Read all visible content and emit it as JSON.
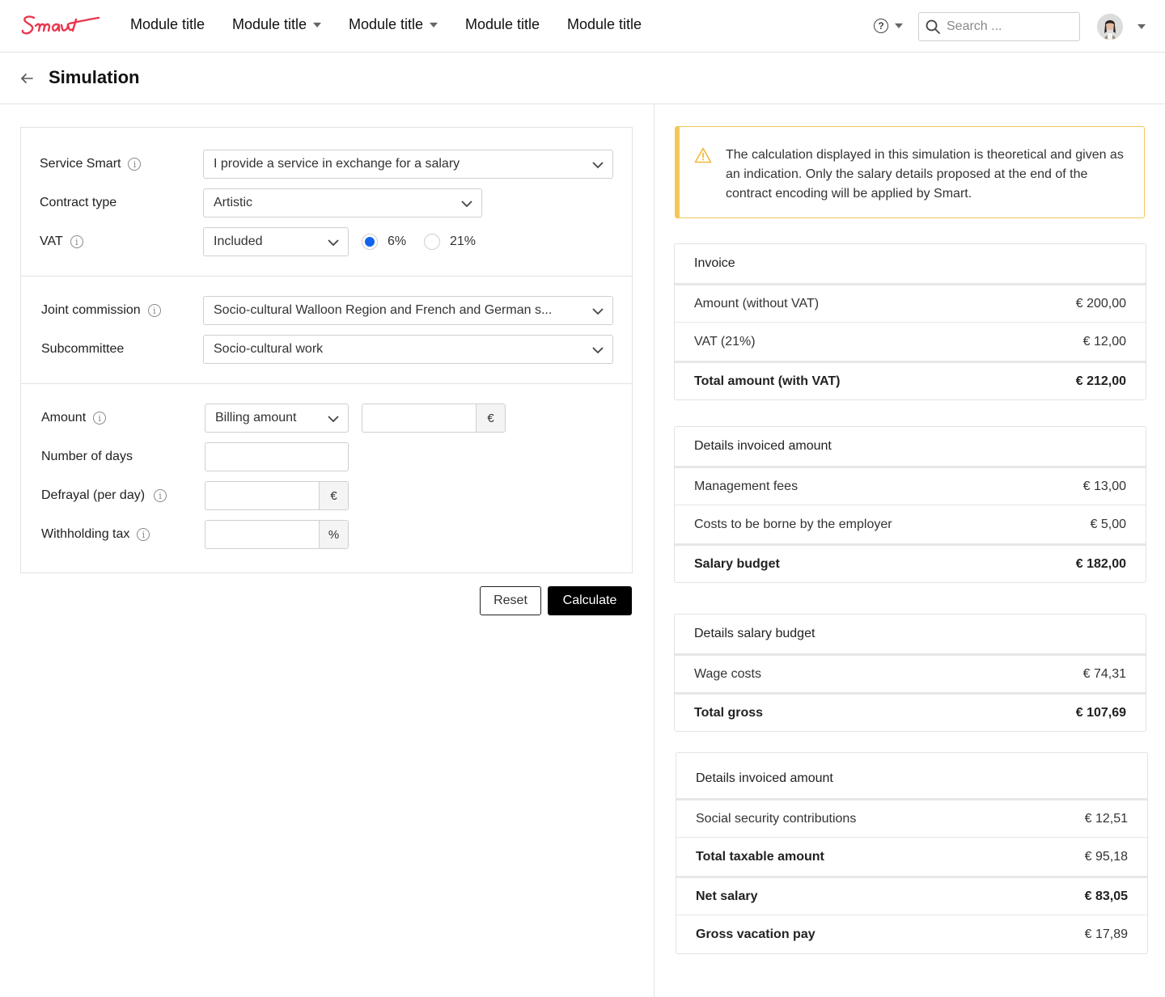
{
  "brand": {
    "logo_text": "Smart",
    "accent": "#e8384f"
  },
  "nav": {
    "items": [
      {
        "label": "Module title",
        "has_dropdown": false
      },
      {
        "label": "Module title",
        "has_dropdown": true
      },
      {
        "label": "Module title",
        "has_dropdown": true
      },
      {
        "label": "Module title",
        "has_dropdown": false
      },
      {
        "label": "Module title",
        "has_dropdown": false
      }
    ],
    "help_icon": "question-circle-icon",
    "search_placeholder": "Search ...",
    "avatar_icon": "user-avatar"
  },
  "page": {
    "title": "Simulation",
    "back_icon": "arrow-left-icon"
  },
  "form": {
    "service_smart": {
      "label": "Service Smart",
      "value": "I provide a service in exchange for a salary"
    },
    "contract_type": {
      "label": "Contract type",
      "value": "Artistic"
    },
    "vat": {
      "label": "VAT",
      "value": "Included",
      "options": [
        {
          "label": "6%",
          "selected": true
        },
        {
          "label": "21%",
          "selected": false
        }
      ]
    },
    "joint_commission": {
      "label": "Joint commission",
      "value": "Socio-cultural Walloon Region and French and German s..."
    },
    "subcommittee": {
      "label": "Subcommittee",
      "value": "Socio-cultural work"
    },
    "amount": {
      "label": "Amount",
      "type_value": "Billing amount",
      "value": "",
      "unit": "€"
    },
    "number_of_days": {
      "label": "Number of days",
      "value": ""
    },
    "defrayal": {
      "label": "Defrayal (per day)",
      "value": "",
      "unit": "€"
    },
    "withholding_tax": {
      "label": "Withholding tax",
      "value": "",
      "unit": "%"
    },
    "reset_label": "Reset",
    "calculate_label": "Calculate"
  },
  "alert": {
    "icon": "warning-icon",
    "color": "#f2c75c",
    "text": "The calculation displayed in this simulation is theoretical and given as an indication. Only the salary details proposed at the end of the contract encoding will be applied by Smart."
  },
  "cards": [
    {
      "title": "Invoice",
      "rows": [
        {
          "label": "Amount (without VAT)",
          "value": "€ 200,00",
          "total": false
        },
        {
          "label": "VAT (21%)",
          "value": "€ 12,00",
          "total": false
        },
        {
          "label": "Total amount (with VAT)",
          "value": "€ 212,00",
          "total": true
        }
      ]
    },
    {
      "title": "Details invoiced amount",
      "rows": [
        {
          "label": "Management fees",
          "value": "€ 13,00",
          "total": false
        },
        {
          "label": "Costs to be borne by the employer",
          "value": "€ 5,00",
          "total": false
        },
        {
          "label": "Salary budget",
          "value": "€ 182,00",
          "total": true
        }
      ]
    },
    {
      "title": "Details salary budget",
      "rows": [
        {
          "label": "Wage costs",
          "value": "€ 74,31",
          "total": false
        },
        {
          "label": "Total gross",
          "value": "€ 107,69",
          "total": true
        }
      ]
    },
    {
      "title": "Details invoiced amount",
      "rows": [
        {
          "label": "Social security contributions",
          "value": "€ 12,51",
          "total": false
        },
        {
          "label": "Total taxable amount",
          "value": "€ 95,18",
          "total": false
        },
        {
          "label": "Net salary",
          "value": "€ 83,05",
          "total": true
        },
        {
          "label": "Gross vacation pay",
          "value": "€ 17,89",
          "total": false
        }
      ]
    }
  ]
}
